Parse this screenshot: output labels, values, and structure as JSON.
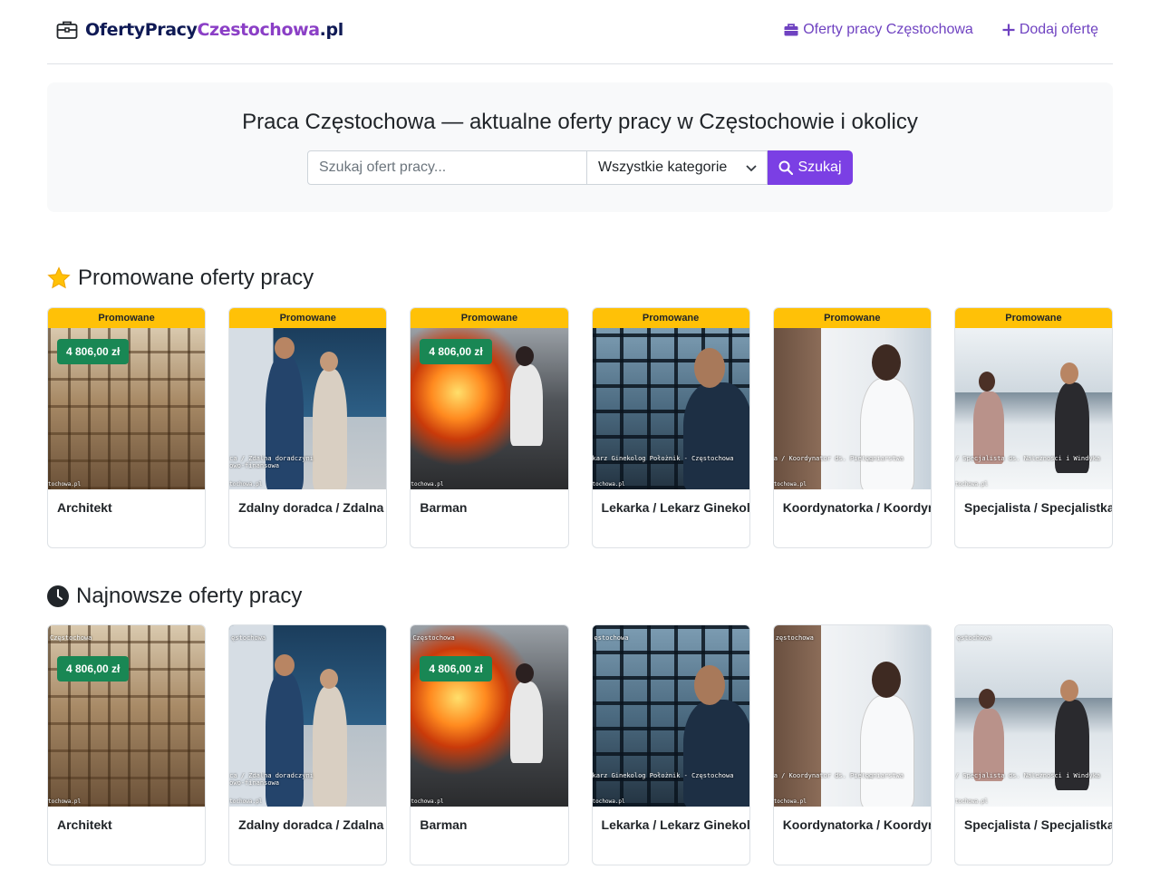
{
  "header": {
    "logo": {
      "part1": "OfertyPracy",
      "part2": "Czestochowa",
      "part3": ".pl"
    },
    "nav": [
      {
        "label": "Oferty pracy Częstochowa",
        "icon": "briefcase-icon"
      },
      {
        "label": "Dodaj ofertę",
        "icon": "plus-icon"
      }
    ]
  },
  "hero": {
    "title": "Praca Częstochowa — aktualne oferty pracy w Częstochowie i okolicy",
    "search_placeholder": "Szukaj ofert pracy...",
    "category_selected": "Wszystkie kategorie",
    "search_button": "Szukaj"
  },
  "promoted": {
    "title": "Promowane oferty pracy",
    "icon": "star-icon",
    "badge": "Promowane",
    "cards": [
      {
        "title": "Architekt",
        "salary": "4 806,00 zł",
        "caption": "",
        "foot": "tochowa.pl"
      },
      {
        "title": "Zdalny doradca / Zdalna",
        "salary": "",
        "caption": "ca / Zdalna doradczyni\nowo-finansowa",
        "foot": "tochowa.pl"
      },
      {
        "title": "Barman",
        "salary": "4 806,00 zł",
        "caption": "",
        "foot": "tochowa.pl"
      },
      {
        "title": "Lekarka / Lekarz Ginekol",
        "salary": "",
        "caption": "karz Ginekolog Położnik - Częstochowa",
        "foot": "tochowa.pl"
      },
      {
        "title": "Koordynatorka / Koordyn",
        "salary": "",
        "caption": "a / Koordynator ds. Pielęgniarstwa",
        "foot": "tochowa.pl"
      },
      {
        "title": "Specjalista / Specjalistka",
        "salary": "",
        "caption": "/ Specjalista ds. Należności i Windyka",
        "foot": "tochowa.pl"
      }
    ]
  },
  "newest": {
    "title": "Najnowsze oferty pracy",
    "icon": "clock-icon",
    "cards": [
      {
        "title": "Architekt",
        "salary": "4 806,00 zł",
        "top": "Częstochowa",
        "caption": "",
        "foot": "tochowa.pl"
      },
      {
        "title": "Zdalny doradca / Zdalna",
        "salary": "",
        "top": "ęstochowa",
        "caption": "ca / Zdalna doradczyni\nowo-finansowa",
        "foot": "tochowa.pl"
      },
      {
        "title": "Barman",
        "salary": "4 806,00 zł",
        "top": "Częstochowa",
        "caption": "",
        "foot": "tochowa.pl"
      },
      {
        "title": "Lekarka / Lekarz Ginekol",
        "salary": "",
        "top": "ęstochowa",
        "caption": "karz Ginekolog Położnik - Częstochowa",
        "foot": "tochowa.pl"
      },
      {
        "title": "Koordynatorka / Koordyn",
        "salary": "",
        "top": "zęstochowa",
        "caption": "a / Koordynator ds. Pielęgniarstwa",
        "foot": "tochowa.pl"
      },
      {
        "title": "Specjalista / Specjalistka",
        "salary": "",
        "top": "ęstochowa",
        "caption": "/ Specjalista ds. Należności i Windyka",
        "foot": "tochowa.pl"
      }
    ]
  },
  "colors": {
    "accent": "#6f42c1",
    "promo": "#ffc107",
    "salary": "#198754"
  }
}
